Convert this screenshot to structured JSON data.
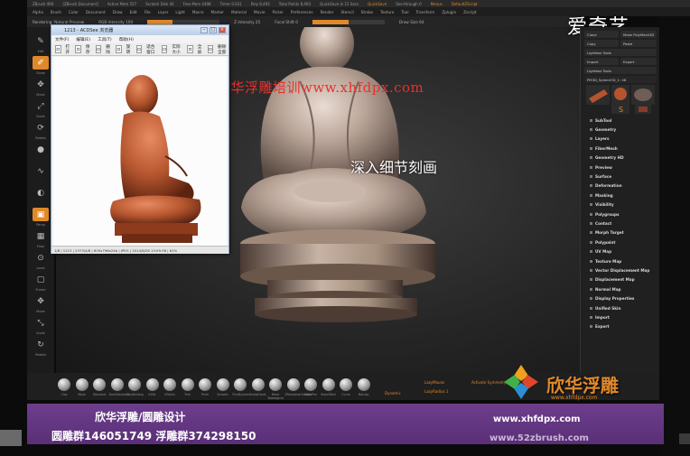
{
  "window": {
    "title_items": [
      "ZBrush 4R6",
      "[ZBrush Document]",
      "Active Mem 557",
      "Scratch Disk 44",
      "Free Mem 4498",
      "Timer 0.031",
      "Poly 8,493",
      "Total Points 8,493",
      "QuickSave In 15 Secs"
    ],
    "quicksave_label": "QuickSave",
    "see_through_label": "See-through 0",
    "menus_label": "Menus",
    "default_script_label": "DefaultZScript"
  },
  "menubar": {
    "items": [
      "Alpha",
      "Brush",
      "Color",
      "Document",
      "Draw",
      "Edit",
      "File",
      "Layer",
      "Light",
      "Macro",
      "Marker",
      "Material",
      "Movie",
      "Picker",
      "Preferences",
      "Render",
      "Stencil",
      "Stroke",
      "Texture",
      "Tool",
      "Transform",
      "Zplugin",
      "Zscript"
    ]
  },
  "toolrow": {
    "label_a": "Rendering: Natural Preview",
    "label_b": "Z Intensity 25",
    "label_c": "Focal Shift 0",
    "label_d": "Draw Size 64",
    "label_e": "RGB Intensity 100",
    "rgb_fill": 0.35,
    "focal_fill": 0.5
  },
  "leftshelf": {
    "items": [
      {
        "cap": "Edit",
        "icon": "edit-icon",
        "on": false
      },
      {
        "cap": "Draw",
        "icon": "draw-icon",
        "on": true
      },
      {
        "cap": "Move",
        "icon": "move-icon",
        "on": false
      },
      {
        "cap": "Scale",
        "icon": "scale-icon",
        "on": false
      },
      {
        "cap": "Rotate",
        "icon": "rotate-icon",
        "on": false
      },
      {
        "cap": "",
        "icon": "brush-icon",
        "on": false
      },
      {
        "cap": "",
        "icon": "stroke-icon",
        "on": false
      },
      {
        "cap": "",
        "icon": "material-sphere-icon",
        "on": false
      },
      {
        "cap": "Persp",
        "icon": "perspective-icon",
        "on": true
      },
      {
        "cap": "Floor",
        "icon": "floor-icon",
        "on": false
      },
      {
        "cap": "Local",
        "icon": "local-icon",
        "on": false
      },
      {
        "cap": "Frame",
        "icon": "frame-icon",
        "on": false
      },
      {
        "cap": "Move",
        "icon": "move-view-icon",
        "on": false
      },
      {
        "cap": "Scale",
        "icon": "scale-view-icon",
        "on": false
      },
      {
        "cap": "Rotate",
        "icon": "rotate-view-icon",
        "on": false
      }
    ]
  },
  "viewer": {
    "title": "1213 - ACDSee 浏览器",
    "menu": [
      "文件(F)",
      "编辑(E)",
      "工具(T)",
      "帮助(H)"
    ],
    "toolbar": [
      "打开",
      "保存",
      "删除",
      "旋转",
      "适合窗口",
      "实际大小",
      "全屏",
      "删除全部"
    ],
    "status": "1/8  |  1213  |  2373/4/8  |  605x796x24b  |  JPEG  |  2014/8/26 13:09:38  |  61%"
  },
  "rightpalette": {
    "top_buttons": [
      "Clone",
      "Make PolyMesh3D",
      "Copy",
      "Paste",
      "Lightbox Tools",
      "Import",
      "Export",
      "Lightbox Tools"
    ],
    "tool_name": "PM3D_Sphere3D_1: 48",
    "menu": [
      "SubTool",
      "Geometry",
      "Layers",
      "FiberMesh",
      "Geometry HD",
      "Preview",
      "Surface",
      "Deformation",
      "Masking",
      "Visibility",
      "Polygroups",
      "Contact",
      "Morph Target",
      "Polypaint",
      "UV Map",
      "Texture Map",
      "Vector Displacement Map",
      "Displacement Map",
      "Normal Map",
      "Display Properties",
      "Unified Skin",
      "Import",
      "Export"
    ]
  },
  "brushshelf": {
    "brushes": [
      "Clay",
      "Move",
      "Standard",
      "DamStandard",
      "ClayBuildup",
      "Inflat",
      "hPolish",
      "Trim",
      "Pinch",
      "Smooth",
      "TrimDynamic",
      "SnakeHook",
      "Move Topological",
      "ZRemesherGuides",
      "MaskPen",
      "SelectRect",
      "Curve",
      "Matcap"
    ],
    "lazy_label": "LazyMouse",
    "lazy_radius": "LazyRadius 1",
    "dynamic_label": "Dynamic",
    "activate_label": "Activate Symmetry"
  },
  "watermarks": {
    "url_red": "欣华浮雕培训www.xhfdpx.com",
    "subtitle": "深入细节刻画",
    "iqiyi": "爱奇艺"
  },
  "banner": {
    "line1": "欣华浮雕/圆雕设计",
    "line2": "圆雕群146051749   浮雕群374298150",
    "url1": "www.xhfdpx.com",
    "url2": "www.52zbrush.com",
    "brand": "欣华浮雕",
    "brand_sub": "www.xhfdpx.com"
  },
  "colors": {
    "accent": "#e0892a",
    "banner_purple": "#643785",
    "clay": "#b4552e"
  }
}
